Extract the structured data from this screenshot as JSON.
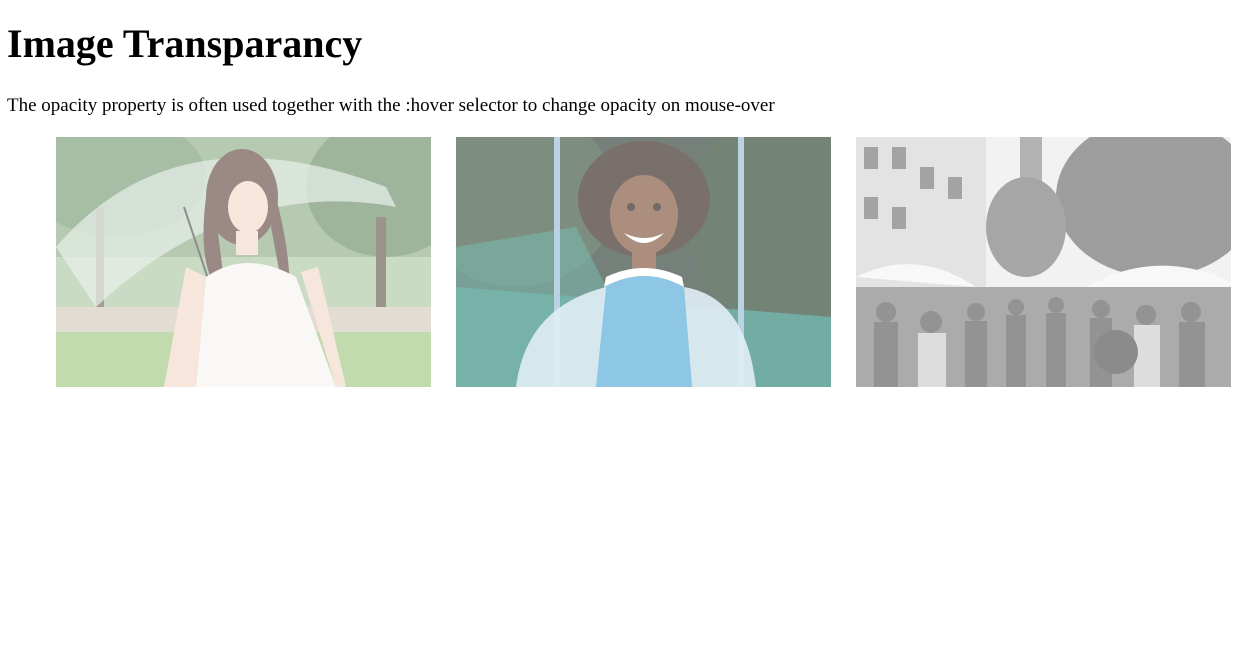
{
  "page": {
    "title": "Image Transparancy",
    "description": "The opacity property is often used together with the :hover selector to change opacity on mouse-over"
  },
  "gallery": {
    "images": [
      {
        "name": "woman-with-umbrella-photo",
        "subject": "woman with transparent umbrella in park"
      },
      {
        "name": "girl-on-swing-photo",
        "subject": "smiling girl on swing"
      },
      {
        "name": "crowded-street-photo",
        "subject": "crowded city street, black and white"
      }
    ]
  },
  "colors": {
    "background": "#ffffff",
    "text": "#000000"
  }
}
